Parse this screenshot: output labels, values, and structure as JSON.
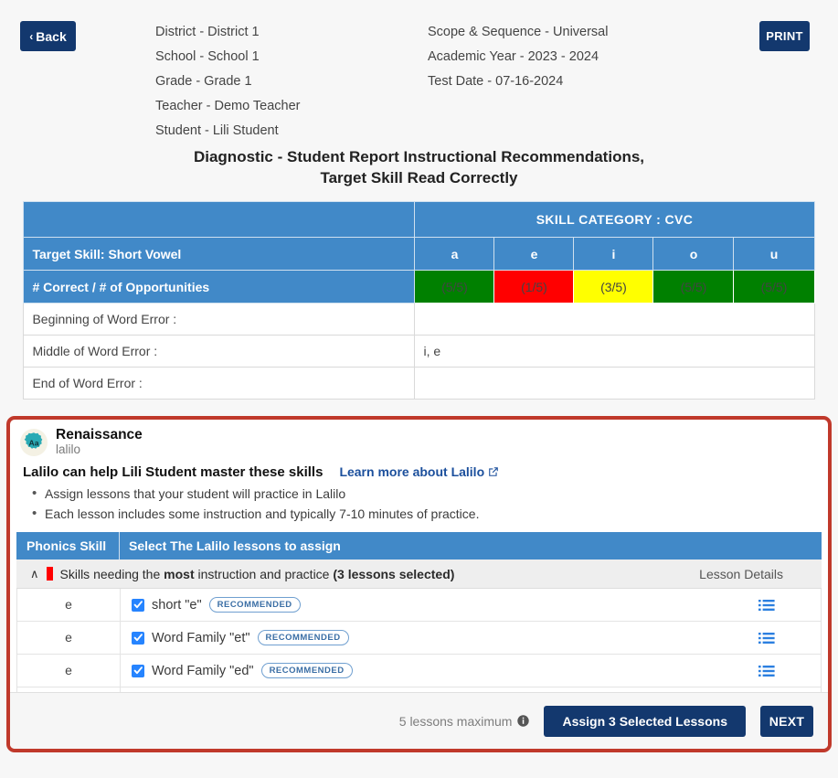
{
  "toolbar": {
    "back_label": "Back",
    "back_chevron": "‹",
    "print_label": "PRINT"
  },
  "meta_left": [
    "District -  District 1",
    "School - School 1",
    "Grade - Grade 1",
    "Teacher - Demo Teacher",
    "Student - Lili Student"
  ],
  "meta_right": [
    "Scope & Sequence - Universal",
    "Academic Year - 2023 - 2024",
    "Test Date - 07-16-2024"
  ],
  "report": {
    "title_line1": "Diagnostic - Student Report Instructional Recommendations,",
    "title_line2": "Target Skill Read Correctly"
  },
  "score_table": {
    "category_header": "SKILL CATEGORY : CVC",
    "target_skill_label": "Target Skill: Short Vowel",
    "vowels": [
      "a",
      "e",
      "i",
      "o",
      "u"
    ],
    "opportunities_label": "# Correct / # of Opportunities",
    "scores": [
      {
        "value": "(5/5)",
        "status": "green"
      },
      {
        "value": "(1/5)",
        "status": "red"
      },
      {
        "value": "(3/5)",
        "status": "yellow"
      },
      {
        "value": "(5/5)",
        "status": "green"
      },
      {
        "value": "(5/5)",
        "status": "green"
      }
    ],
    "error_rows": [
      {
        "label": "Beginning of Word Error :",
        "value": ""
      },
      {
        "label": "Middle of Word Error :",
        "value": "i, e"
      },
      {
        "label": "End of Word Error :",
        "value": ""
      }
    ]
  },
  "lalilo": {
    "brand_name": "Renaissance",
    "brand_sub": "lalilo",
    "logo_text": "Aa",
    "headline": "Lalilo can help Lili Student master these skills",
    "learn_more": "Learn more about Lalilo",
    "bullets": [
      "Assign lessons that your student will practice in Lalilo",
      "Each lesson includes some instruction and typically 7-10 minutes of practice."
    ],
    "table_headers": {
      "skill": "Phonics Skill",
      "select": "Select The Lalilo lessons to assign",
      "details": "Lesson Details"
    },
    "group": {
      "prefix": "Skills needing the ",
      "emphasis": "most",
      "middle": " instruction and practice ",
      "count": "(3 lessons selected)",
      "collapse_chevron": "∧"
    },
    "lessons": [
      {
        "skill": "e",
        "name": "short \"e\"",
        "badge": "RECOMMENDED",
        "checked": true
      },
      {
        "skill": "e",
        "name": "Word Family \"et\"",
        "badge": "RECOMMENDED",
        "checked": true
      },
      {
        "skill": "e",
        "name": "Word Family \"ed\"",
        "badge": "RECOMMENDED",
        "checked": true
      }
    ],
    "footer": {
      "max_note": "5 lessons maximum",
      "assign_label": "Assign 3 Selected Lessons",
      "next_label": "NEXT"
    }
  },
  "colors": {
    "navy": "#13386e",
    "table_blue": "#4189c8",
    "panel_red": "#c0392b",
    "green": "#008000",
    "red": "#ff0000",
    "yellow": "#ffff00",
    "link_blue": "#1b4f9c",
    "checkbox_blue": "#2684ff"
  }
}
